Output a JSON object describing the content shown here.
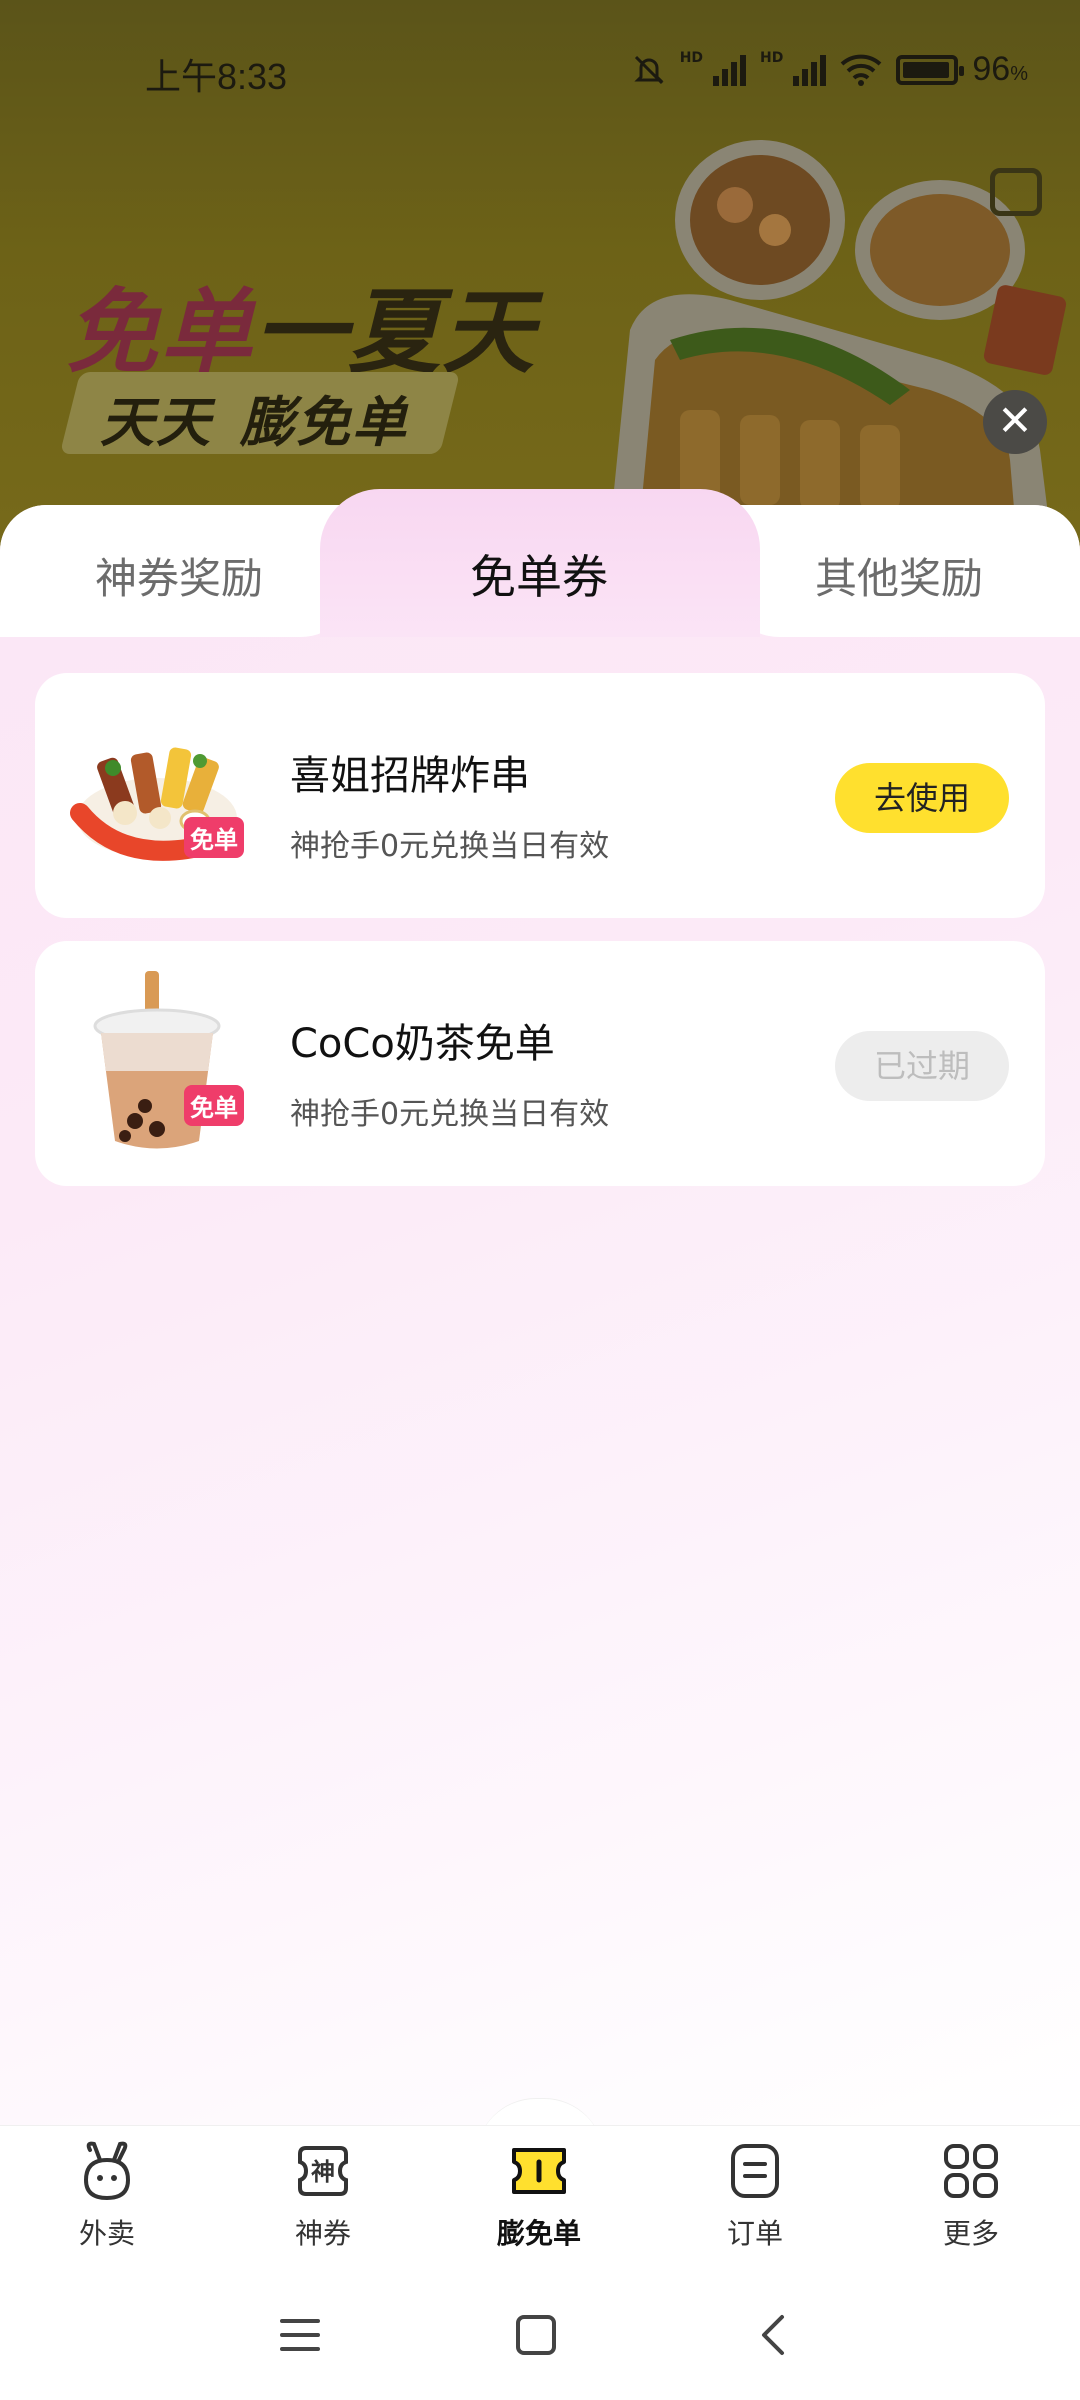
{
  "status_bar": {
    "time": "上午8:33",
    "battery_percent": "96",
    "battery_unit": "%",
    "battery_level": 0.96
  },
  "banner": {
    "title_part1": "免单",
    "title_part2": "一夏天",
    "subtitle_part1": "天天",
    "subtitle_part2": "膨免单"
  },
  "tabs": [
    {
      "label": "神券奖励",
      "active": false
    },
    {
      "label": "免单券",
      "active": true
    },
    {
      "label": "其他奖励",
      "active": false
    }
  ],
  "coupons": [
    {
      "title": "喜姐招牌炸串",
      "desc": "神抢手0元兑换当日有效",
      "badge": "免单",
      "button": "去使用",
      "status": "usable"
    },
    {
      "title": "CoCo奶茶免单",
      "desc": "神抢手0元兑换当日有效",
      "badge": "免单",
      "button": "已过期",
      "status": "expired"
    }
  ],
  "bottom_nav": [
    {
      "label": "外卖",
      "icon": "rabbit-icon"
    },
    {
      "label": "神券",
      "icon": "coupon-icon"
    },
    {
      "label": "膨免单",
      "icon": "ticket-icon",
      "active": true
    },
    {
      "label": "订单",
      "icon": "order-icon"
    },
    {
      "label": "更多",
      "icon": "grid-icon"
    }
  ],
  "colors": {
    "accent_yellow": "#ffe02e",
    "badge_pink": "#ef3d6a",
    "sheet_pink": "#fbe6f6"
  }
}
